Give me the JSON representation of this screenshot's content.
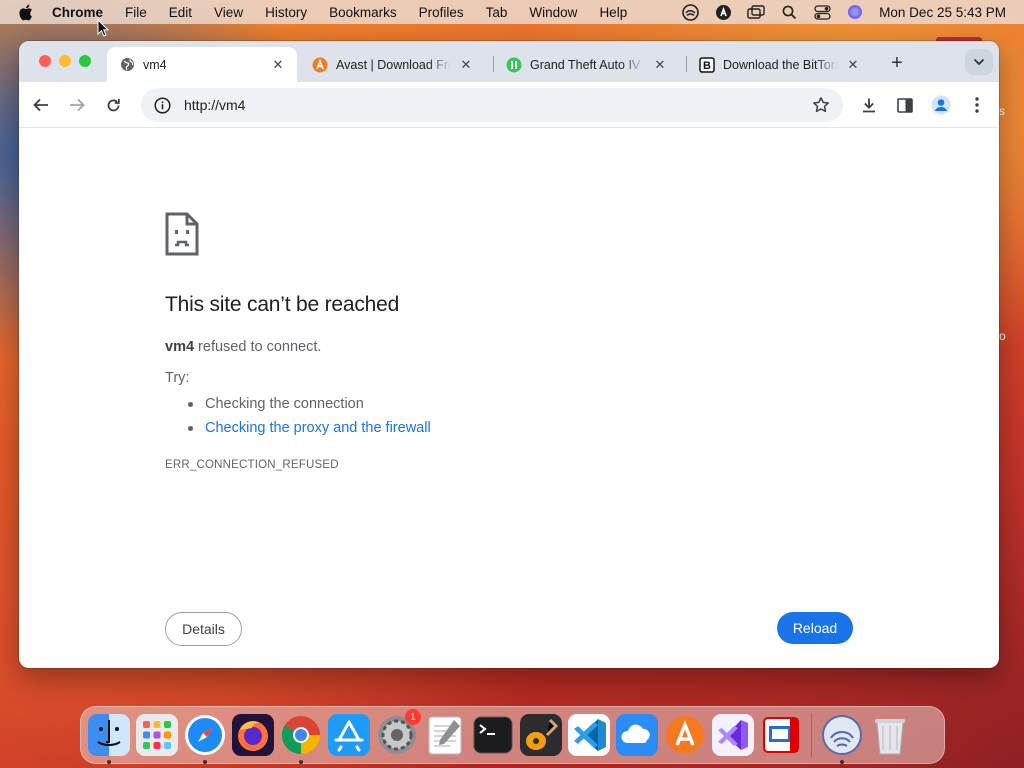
{
  "menubar": {
    "app_name": "Chrome",
    "items": [
      "File",
      "Edit",
      "View",
      "History",
      "Bookmarks",
      "Profiles",
      "Tab",
      "Window",
      "Help"
    ],
    "clock": "Mon Dec 25  5:43 PM",
    "status_icons": [
      "bittorrent-icon",
      "avast-icon",
      "window-switcher-icon",
      "spotlight-search-icon",
      "control-center-icon",
      "siri-icon"
    ]
  },
  "tabs": [
    {
      "title": "vm4",
      "favicon": "globe-icon",
      "active": true
    },
    {
      "title": "Avast | Download Free",
      "favicon": "avast-icon",
      "active": false
    },
    {
      "title": "Grand Theft Auto IV N",
      "favicon": "green-circle-icon",
      "active": false
    },
    {
      "title": "Download the BitTorrent",
      "favicon": "b-letter-icon",
      "active": false
    }
  ],
  "omnibox": {
    "url": "http://vm4"
  },
  "error_page": {
    "title": "This site can’t be reached",
    "host": "vm4",
    "description_suffix": " refused to connect.",
    "try_label": "Try:",
    "suggestions": [
      {
        "text": "Checking the connection",
        "link": false
      },
      {
        "text": "Checking the proxy and the firewall",
        "link": true
      }
    ],
    "error_code": "ERR_CONNECTION_REFUSED",
    "details_label": "Details",
    "reload_label": "Reload"
  },
  "dock": {
    "apps": [
      "Finder",
      "Launchpad",
      "Safari",
      "Firefox",
      "Google Chrome",
      "App Store",
      "System Preferences",
      "TextEdit",
      "Terminal",
      "GarageBand",
      "Visual Studio Code",
      "iCloud",
      "Avast",
      "Visual Studio",
      "Remote Desktop",
      "BitTorrent",
      "Trash"
    ],
    "system_preferences_badge": "1"
  },
  "colors": {
    "accent": "#1a73e8",
    "tabstrip": "#dee3eb"
  }
}
